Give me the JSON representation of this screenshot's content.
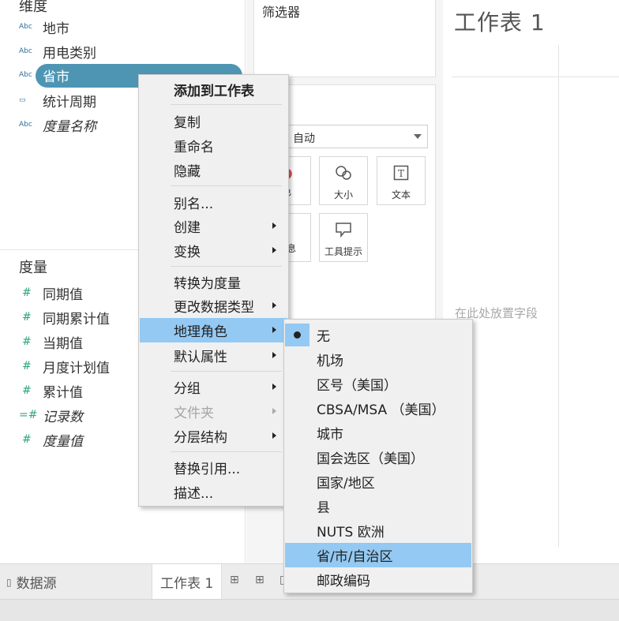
{
  "left_pane": {
    "dimensions_header": "维度",
    "dimensions": [
      {
        "icon": "Abc",
        "label": "地市"
      },
      {
        "icon": "Abc",
        "label": "用电类别"
      },
      {
        "icon": "Abc",
        "label": "省市"
      },
      {
        "icon": "▭",
        "label": "统计周期"
      },
      {
        "icon": "Abc",
        "label": "度量名称"
      }
    ],
    "measures_header": "度量",
    "measures": [
      {
        "icon": "#",
        "label": "同期值"
      },
      {
        "icon": "#",
        "label": "同期累计值"
      },
      {
        "icon": "#",
        "label": "当期值"
      },
      {
        "icon": "#",
        "label": "月度计划值"
      },
      {
        "icon": "#",
        "label": "累计值"
      },
      {
        "icon": "=#",
        "label": "记录数"
      },
      {
        "icon": "#",
        "label": "度量值"
      }
    ]
  },
  "shelves": {
    "filters_title": "筛选器",
    "marks_type": "自动",
    "buttons": [
      {
        "icon": "color-icon",
        "label": "色"
      },
      {
        "icon": "size-icon",
        "label": "大小"
      },
      {
        "icon": "text-icon",
        "label": "文本"
      },
      {
        "icon": "detail-icon",
        "label": "信息"
      },
      {
        "icon": "tooltip-icon",
        "label": "工具提示"
      }
    ]
  },
  "sheet": {
    "title": "工作表 1",
    "drop_hint": "在此处放置字段"
  },
  "tabs": {
    "data_source": "数据源",
    "active_sheet": "工作表 1"
  },
  "context_menu": {
    "items": [
      {
        "label": "添加到工作表"
      },
      {
        "label": "复制"
      },
      {
        "label": "重命名"
      },
      {
        "label": "隐藏"
      },
      {
        "label": "别名..."
      },
      {
        "label": "创建"
      },
      {
        "label": "变换"
      },
      {
        "label": "转换为度量"
      },
      {
        "label": "更改数据类型"
      },
      {
        "label": "地理角色"
      },
      {
        "label": "默认属性"
      },
      {
        "label": "分组"
      },
      {
        "label": "文件夹"
      },
      {
        "label": "分层结构"
      },
      {
        "label": "替换引用..."
      },
      {
        "label": "描述..."
      }
    ]
  },
  "geo_submenu": {
    "items": [
      {
        "label": "无"
      },
      {
        "label": "机场"
      },
      {
        "label": "区号（美国）"
      },
      {
        "label": "CBSA/MSA （美国）"
      },
      {
        "label": "城市"
      },
      {
        "label": "国会选区（美国）"
      },
      {
        "label": "国家/地区"
      },
      {
        "label": "县"
      },
      {
        "label": "NUTS 欧洲"
      },
      {
        "label": "省/市/自治区"
      },
      {
        "label": "邮政编码"
      }
    ]
  },
  "colors": {
    "selected_pill": "#4e95b4",
    "menu_highlight": "#93c9f2",
    "dimension_icon": "#2f6f99",
    "measure_icon": "#2aa77a"
  }
}
